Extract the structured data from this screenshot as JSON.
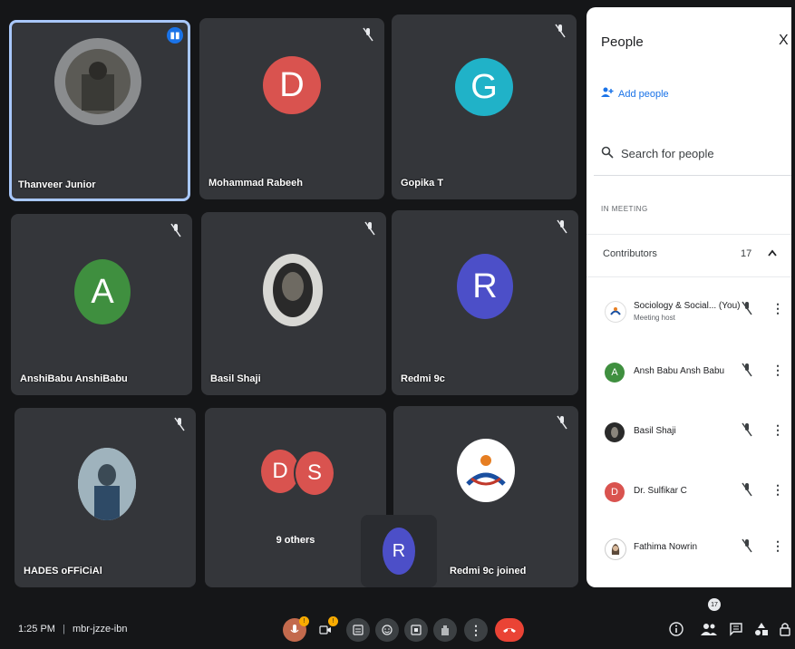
{
  "tiles": [
    {
      "name": "Thanveer Junior"
    },
    {
      "name": "Mohammad Rabeeh",
      "initial": "D"
    },
    {
      "name": "Gopika T",
      "initial": "G"
    },
    {
      "name": "AnshiBabu AnshiBabu",
      "initial": "A"
    },
    {
      "name": "Basil Shaji"
    },
    {
      "name": "Redmi 9c",
      "initial": "R"
    },
    {
      "name": "HADES oFFiCiAl"
    },
    {
      "name": "9 others",
      "initials": [
        "D",
        "S"
      ]
    },
    {
      "name": "Redmi 9c joined",
      "initial": "R"
    }
  ],
  "panel": {
    "title": "People",
    "close": "X",
    "add_people": "Add people",
    "search_placeholder": "Search for people",
    "section_label": "IN MEETING",
    "contributors_label": "Contributors",
    "contributors_count": "17",
    "people": [
      {
        "name": "Sociology & Social... (You)",
        "sub": "Meeting host"
      },
      {
        "name": "Ansh Babu Ansh Babu",
        "initial": "A"
      },
      {
        "name": "Basil Shaji"
      },
      {
        "name": "Dr. Sulfikar C",
        "initial": "D"
      },
      {
        "name": "Fathima Nowrin"
      }
    ]
  },
  "bottombar": {
    "time": "1:25 PM",
    "separator": "|",
    "meeting_code": "mbr-jzze-ibn",
    "people_count": "17"
  },
  "colors": {
    "tile_bg": "#34363a",
    "avatar_red": "#d9534f",
    "avatar_cyan": "#20b2c8",
    "avatar_green": "#3f8f3f",
    "avatar_indigo": "#4c4fc8",
    "end_call": "#ea4335",
    "accent": "#1a73e8"
  }
}
